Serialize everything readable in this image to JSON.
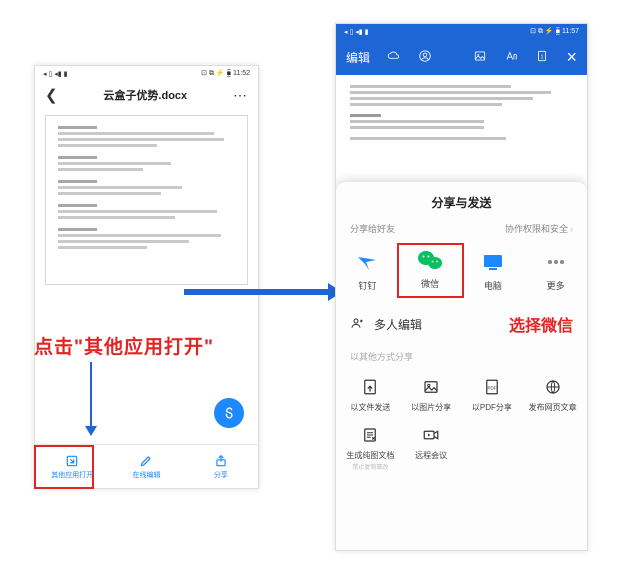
{
  "left": {
    "status": {
      "left": "◂ ▯ ◂▮ ▮",
      "right": "⊡ ⧉ ⚡ ⧯ 11:52"
    },
    "title": "云盒子优势.docx",
    "fab_icon": "S",
    "bottom": [
      {
        "label": "其他应用打开"
      },
      {
        "label": "在线编辑"
      },
      {
        "label": "分享"
      }
    ]
  },
  "annotations": {
    "left": "点击\"其他应用打开\"",
    "right": "选择微信"
  },
  "right": {
    "status": {
      "left": "◂ ▯ ◂▮ ▮",
      "right": "⊡ ⧉ ⚡ ⧯ 11:57"
    },
    "toolbar": {
      "edit": "编辑",
      "close": "×"
    },
    "sheet": {
      "title": "分享与发送",
      "friends_label": "分享给好友",
      "perm_label": "协作权限和安全",
      "share_items": [
        {
          "label": "钉钉"
        },
        {
          "label": "微信"
        },
        {
          "label": "电脑"
        },
        {
          "label": "更多"
        }
      ],
      "multi_edit": "多人编辑",
      "other_ways": "以其他方式分享",
      "actions": [
        {
          "label": "以文件发送",
          "sub": ""
        },
        {
          "label": "以图片分享",
          "sub": ""
        },
        {
          "label": "以PDF分享",
          "sub": ""
        },
        {
          "label": "发布网页文章",
          "sub": ""
        },
        {
          "label": "生成纯图文档",
          "sub": "禁止复制篡改"
        },
        {
          "label": "远程会议",
          "sub": ""
        }
      ]
    }
  }
}
